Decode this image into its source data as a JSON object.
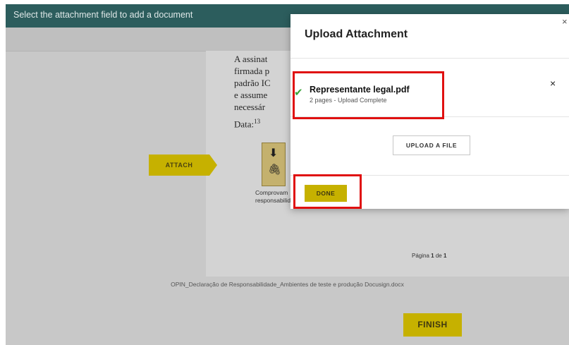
{
  "topbar": {
    "hint": "Select the attachment field to add a document"
  },
  "document": {
    "paragraph": [
      "A assinat",
      "firmada p",
      "padrão IC",
      "e assume",
      "necessár"
    ],
    "data_label": "Data:",
    "data_sup": "13",
    "attach_tag": "ATTACH",
    "attachment_caption": [
      "Comprovam",
      "responsabilida"
    ],
    "page_indicator": {
      "prefix": "Página",
      "current": "1",
      "sep": "de",
      "total": "1"
    },
    "filename": "OPIN_Declaração de Responsabilidade_Ambientes de teste e produção Docusign.docx"
  },
  "finish_label": "FINISH",
  "modal": {
    "title": "Upload Attachment",
    "close_symbol": "×",
    "file": {
      "name": "Representante legal.pdf",
      "status": "2 pages - Upload Complete",
      "remove_symbol": "×"
    },
    "upload_label": "UPLOAD A FILE",
    "done_label": "DONE"
  },
  "colors": {
    "topbar": "#2c5d5d",
    "accent_yellow": "#c6b100",
    "highlight": "#e01010",
    "check": "#3aa53a"
  }
}
